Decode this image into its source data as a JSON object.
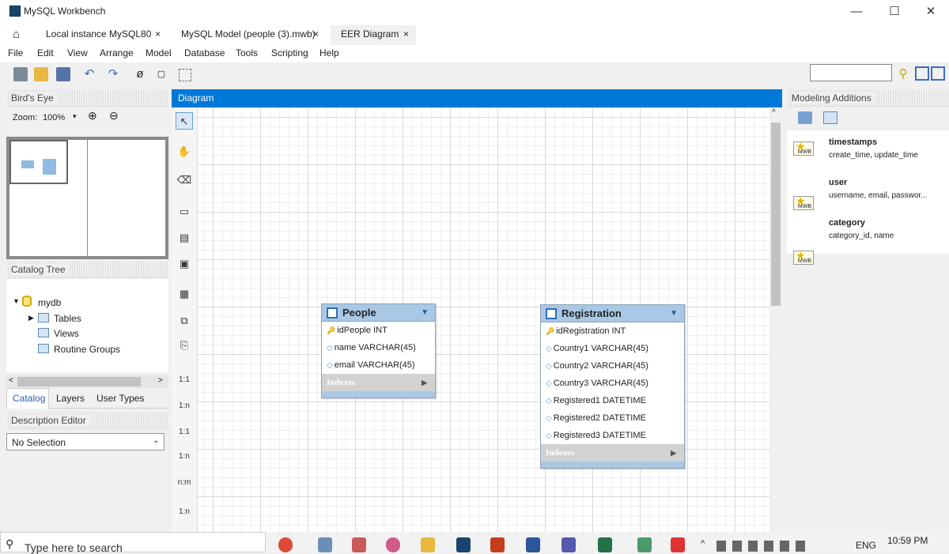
{
  "window": {
    "title": "MySQL Workbench",
    "min": "—",
    "max": "☐",
    "close": "✕"
  },
  "tabs": [
    {
      "label": "Local instance MySQL80"
    },
    {
      "label": "MySQL Model (people (3).mwb)"
    },
    {
      "label": "EER Diagram"
    }
  ],
  "tab_close": "×",
  "menu": [
    "File",
    "Edit",
    "View",
    "Arrange",
    "Model",
    "Database",
    "Tools",
    "Scripting",
    "Help"
  ],
  "birds_eye": {
    "title": "Bird's Eye",
    "zoom_label": "Zoom:",
    "zoom_value": "100%"
  },
  "catalog": {
    "title": "Catalog Tree",
    "db": "mydb",
    "items": [
      "Tables",
      "Views",
      "Routine Groups"
    ],
    "tabs": [
      "Catalog",
      "Layers",
      "User Types"
    ]
  },
  "description": {
    "title": "Description Editor",
    "select": "No Selection"
  },
  "diagram": {
    "title": "Diagram"
  },
  "tools": [
    "1:1",
    "1:n",
    "1:1",
    "1:n",
    "n:m",
    "1:n"
  ],
  "entities": {
    "people": {
      "title": "People",
      "columns": [
        "idPeople INT",
        "name VARCHAR(45)",
        "email VARCHAR(45)"
      ],
      "indexes": "Indexes"
    },
    "registration": {
      "title": "Registration",
      "columns": [
        "idRegistration INT",
        "Country1 VARCHAR(45)",
        "Country2 VARCHAR(45)",
        "Country3 VARCHAR(45)",
        "Registered1 DATETIME",
        "Registered2 DATETIME",
        "Registered3 DATETIME"
      ],
      "indexes": "Indexes"
    }
  },
  "modeling": {
    "title": "Modeling Additions",
    "mwb": "MWB",
    "items": [
      {
        "name": "timestamps",
        "desc": "create_time, update_time"
      },
      {
        "name": "user",
        "desc": "username, email, passwor..."
      },
      {
        "name": "category",
        "desc": "category_id, name"
      }
    ]
  },
  "taskbar": {
    "search": "Type here to search",
    "lang": "ENG",
    "time": "10:59 PM"
  },
  "colors": {
    "accent": "#0078d7",
    "entity_header": "#a9c8e6"
  }
}
